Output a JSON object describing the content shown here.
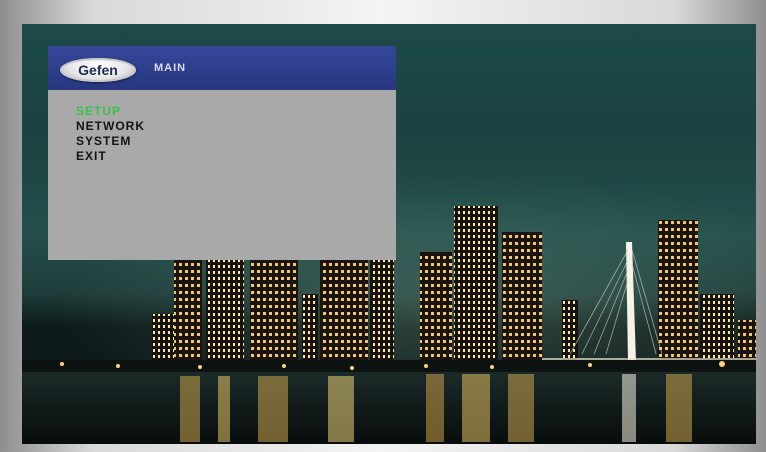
{
  "osd": {
    "logo_text": "Gefen",
    "title": "MAIN",
    "menu_items": [
      {
        "label": "SETUP",
        "selected": true
      },
      {
        "label": "NETWORK",
        "selected": false
      },
      {
        "label": "SYSTEM",
        "selected": false
      },
      {
        "label": "EXIT",
        "selected": false
      }
    ]
  },
  "colors": {
    "header_blue": "#2d3e8c",
    "panel_gray": "#a9a9a9",
    "selected_green": "#39c24a",
    "menu_text": "#141414"
  }
}
